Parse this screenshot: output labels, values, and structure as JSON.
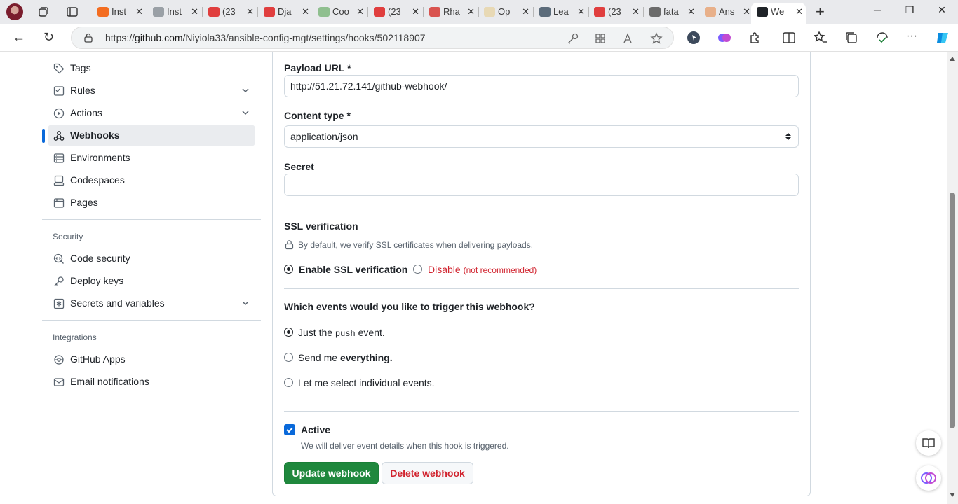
{
  "browser": {
    "tabs": [
      {
        "label": "Inst",
        "color": "#f36d21"
      },
      {
        "label": "Inst",
        "color": "#9aa0a6"
      },
      {
        "label": "(23",
        "color": "#e03e3e"
      },
      {
        "label": "Dja",
        "color": "#e03e3e"
      },
      {
        "label": "Coo",
        "color": "#8fbf8f"
      },
      {
        "label": "(23",
        "color": "#e03e3e"
      },
      {
        "label": "Rha",
        "color": "#d9534f"
      },
      {
        "label": "Op",
        "color": "#e8d9b5"
      },
      {
        "label": "Lea",
        "color": "#5b6b7a"
      },
      {
        "label": "(23",
        "color": "#e03e3e"
      },
      {
        "label": "fata",
        "color": "#6b6b6b"
      },
      {
        "label": "Ans",
        "color": "#e8b08a"
      },
      {
        "label": "We",
        "color": "#1f2328"
      }
    ],
    "url_prefix": "https://",
    "url_host": "github.com",
    "url_path": "/Niyiola33/ansible-config-mgt/settings/hooks/502118907",
    "tab_close": "✕",
    "new_tab": "+",
    "minimize": "─",
    "restore": "❐",
    "close": "✕",
    "back": "←",
    "reload": "↻",
    "more": "···"
  },
  "sidebar": {
    "items": [
      {
        "label": "Tags",
        "icon": "tag-icon"
      },
      {
        "label": "Rules",
        "icon": "rules-icon"
      },
      {
        "label": "Actions",
        "icon": "play-icon"
      },
      {
        "label": "Webhooks",
        "icon": "webhook-icon"
      },
      {
        "label": "Environments",
        "icon": "server-icon"
      },
      {
        "label": "Codespaces",
        "icon": "codespaces-icon"
      },
      {
        "label": "Pages",
        "icon": "browser-icon"
      }
    ],
    "security_heading": "Security",
    "security_items": [
      {
        "label": "Code security",
        "icon": "codescan-icon"
      },
      {
        "label": "Deploy keys",
        "icon": "key-icon"
      },
      {
        "label": "Secrets and variables",
        "icon": "asterisk-icon"
      }
    ],
    "integrations_heading": "Integrations",
    "integration_items": [
      {
        "label": "GitHub Apps",
        "icon": "apps-icon"
      },
      {
        "label": "Email notifications",
        "icon": "mail-icon"
      }
    ]
  },
  "form": {
    "payload_label": "Payload URL *",
    "payload_value": "http://51.21.72.141/github-webhook/",
    "content_type_label": "Content type *",
    "content_type_value": "application/json",
    "secret_label": "Secret",
    "secret_value": "",
    "ssl_heading": "SSL verification",
    "ssl_note": "By default, we verify SSL certificates when delivering payloads.",
    "ssl_enable": "Enable SSL verification",
    "ssl_disable": "Disable",
    "ssl_disable_note": "(not recommended)",
    "events_heading": "Which events would you like to trigger this webhook?",
    "event_push_pre": "Just the",
    "event_push_code": "push",
    "event_push_post": "event.",
    "event_all_pre": "Send me",
    "event_all_bold": "everything.",
    "event_select": "Let me select individual events.",
    "active_label": "Active",
    "active_note": "We will deliver event details when this hook is triggered.",
    "update_button": "Update webhook",
    "delete_button": "Delete webhook"
  },
  "colors": {
    "accent": "#0969da",
    "primary_button": "#1f883d",
    "danger": "#d1242f"
  }
}
